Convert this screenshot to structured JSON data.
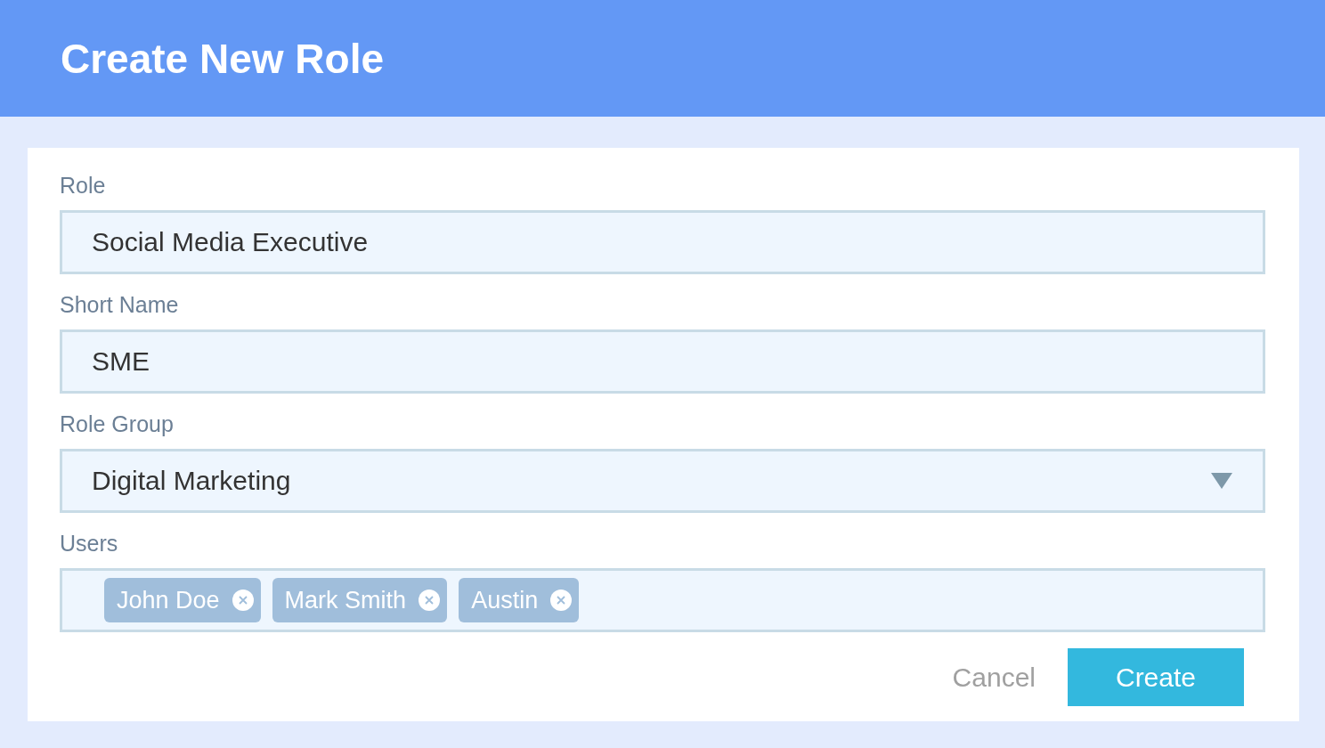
{
  "header": {
    "title": "Create New Role"
  },
  "fields": [
    {
      "kind": "text",
      "label": "Role",
      "value": "Social Media Executive"
    },
    {
      "kind": "text",
      "label": "Short Name",
      "value": "SME"
    },
    {
      "kind": "select",
      "label": "Role Group",
      "value": "Digital Marketing"
    },
    {
      "kind": "tags",
      "label": "Users",
      "tags": [
        "John Doe",
        "Mark Smith",
        "Austin"
      ]
    }
  ],
  "buttons": {
    "cancel": "Cancel",
    "create": "Create"
  }
}
